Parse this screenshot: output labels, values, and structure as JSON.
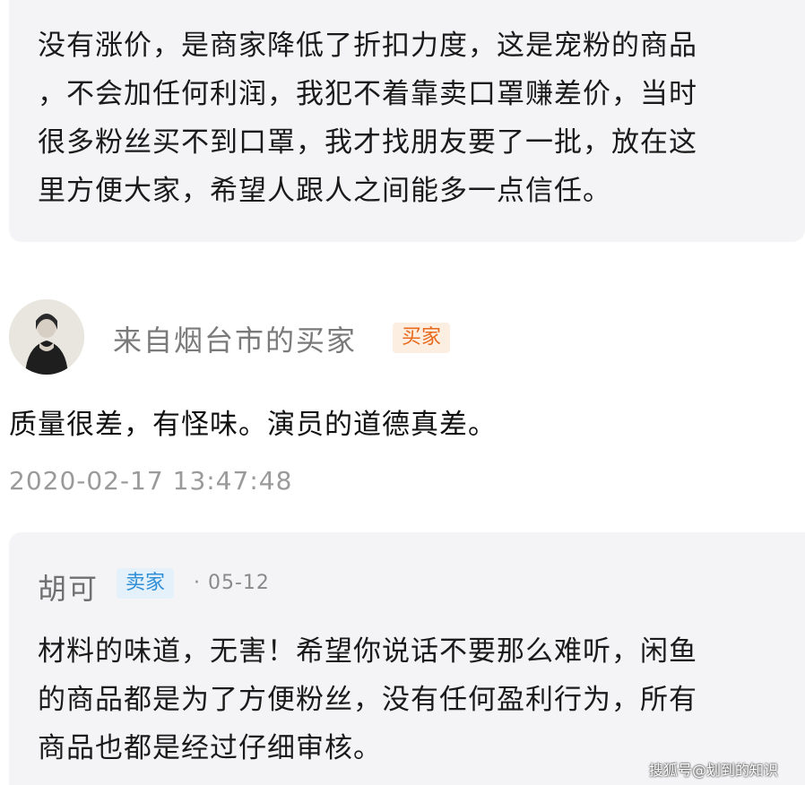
{
  "top_reply": {
    "text": "没有涨价，是商家降低了折扣力度，这是宠粉的商品\n，不会加任何利润，我犯不着靠卖口罩赚差价，当时\n很多粉丝买不到口罩，我才找朋友要了一批，放在这\n里方便大家，希望人跟人之间能多一点信任。"
  },
  "buyer_comment": {
    "user_name": "来自烟台市的买家",
    "badge": "买家",
    "text": "质量很差，有怪味。演员的道德真差。",
    "timestamp": "2020-02-17 13:47:48"
  },
  "seller_reply": {
    "user_name": "胡可",
    "badge": "卖家",
    "date": "· 05-12",
    "text": "材料的味道，无害！希望你说话不要那么难听，闲鱼\n的商品都是为了方便粉丝，没有任何盈利行为，所有\n商品也都是经过仔细审核。"
  },
  "watermark": "搜狐号@划到的知识",
  "colors": {
    "buyer_badge": "#e86a1c",
    "seller_badge": "#2f8fd6",
    "reply_bg": "#f4f4f6"
  }
}
